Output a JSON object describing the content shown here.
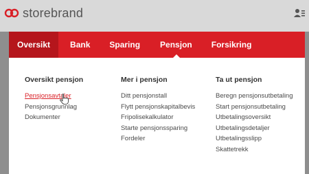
{
  "header": {
    "brand_name": "storebrand",
    "brand_color": "#d91f26",
    "user_icon": "user-menu-icon"
  },
  "nav": {
    "items": [
      {
        "label": "Oversikt"
      },
      {
        "label": "Bank"
      },
      {
        "label": "Sparing"
      },
      {
        "label": "Pensjon"
      },
      {
        "label": "Forsikring"
      }
    ]
  },
  "menu": {
    "columns": [
      {
        "title": "Oversikt pensjon",
        "links": [
          "Pensjonsavtaler",
          "Pensjonsgrunnlag",
          "Dokumenter"
        ]
      },
      {
        "title": "Mer i pensjon",
        "links": [
          "Ditt pensjonstall",
          "Flytt pensjonskapitalbevis",
          "Fripolisekalkulator",
          "Starte pensjonssparing",
          "Fordeler"
        ]
      },
      {
        "title": "Ta ut pensjon",
        "links": [
          "Beregn pensjonsutbetaling",
          "Start pensjonsutbetaling",
          "Utbetalingsoversikt",
          "Utbetalingsdetaljer",
          "Utbetalingsslipp",
          "Skattetrekk"
        ]
      }
    ]
  }
}
